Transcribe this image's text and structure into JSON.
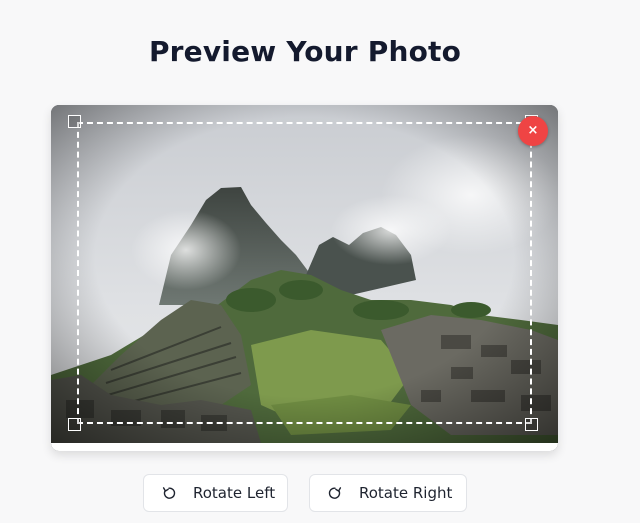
{
  "header": {
    "title": "Preview Your Photo"
  },
  "preview": {
    "remove_label": "×",
    "remove_color": "#ef4444"
  },
  "controls": {
    "rotate_left_label": "Rotate Left",
    "rotate_right_label": "Rotate Right",
    "rotate_left_icon": "rotate-ccw-icon",
    "rotate_right_icon": "rotate-cw-icon"
  }
}
